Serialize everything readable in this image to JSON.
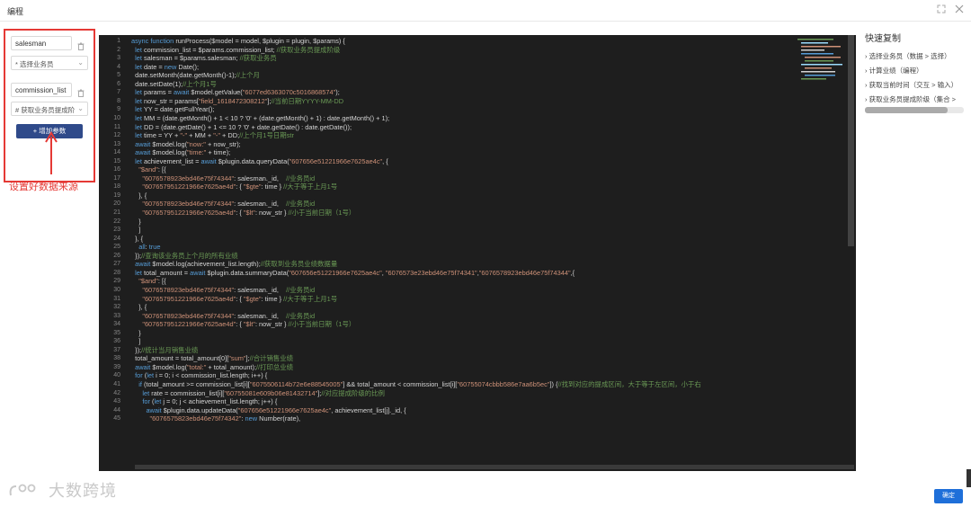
{
  "window": {
    "title": "编程",
    "expand_icon": "expand-icon",
    "close_icon": "close-icon"
  },
  "params": {
    "rows": [
      {
        "name": "salesman",
        "source": "* 选择业务员"
      },
      {
        "name": "commission_list",
        "source": "# 获取业务员提成阶"
      }
    ],
    "add_label": "+ 增加参数",
    "trash_icon": "trash-icon"
  },
  "annotation": "设置好数据来源",
  "editor": {
    "lines": [
      "async function runProcess($model = model, $plugin = plugin, $params) {",
      "  let commission_list = $params.commission_list; //获取业务员提成阶级",
      "  let salesman = $params.salesman; //获取业务员",
      "  let date = new Date();",
      "  date.setMonth(date.getMonth()-1);//上个月",
      "  date.setDate(1);//上个月1号",
      "  let params = await $model.getValue(\"6077ed6363070c5016868574\");",
      "  let now_str = params[\"field_1618472308212\"];//当前日期YYYY-MM-DD",
      "  let YY = date.getFullYear();",
      "  let MM = (date.getMonth() + 1 < 10 ? '0' + (date.getMonth() + 1) : date.getMonth() + 1);",
      "  let DD = (date.getDate() + 1 <= 10 ? '0' + date.getDate() : date.getDate());",
      "  let time = YY + \"-\" + MM + \"-\" + DD;//上个月1号日期str",
      "  await $model.log(\"now:\" + now_str);",
      "  await $model.log(\"time:\" + time);",
      "  let achievement_list = await $plugin.data.queryData(\"607656e51221966e7625ae4c\", {",
      "    \"$and\": [{",
      "      \"6076578923ebd46e75f74344\": salesman._id,    //业务员id",
      "      \"607657951221966e7625ae4d\": { \"$gte\": time } //大于等于上月1号",
      "    }, {",
      "      \"6076578923ebd46e75f74344\": salesman._id,    //业务员id",
      "      \"607657951221966e7625ae4d\": { \"$lt\": now_str } //小于当前日期（1号）",
      "    }",
      "    ]",
      "  }, {",
      "    all: true",
      "  });//查询该业务员上个月的所有业绩",
      "  await $model.log(achievement_list.length);//获取到业务员业绩数据量",
      "  let total_amount = await $plugin.data.summaryData(\"607656e51221966e7625ae4c\", \"6076573e23ebd46e75f74341\",\"6076578923ebd46e75f74344\",{",
      "    \"$and\": [{",
      "      \"6076578923ebd46e75f74344\": salesman._id,    //业务员id",
      "      \"607657951221966e7625ae4d\": { \"$gte\": time } //大于等于上月1号",
      "    }, {",
      "      \"6076578923ebd46e75f74344\": salesman._id,    //业务员id",
      "      \"607657951221966e7625ae4d\": { \"$lt\": now_str } //小于当前日期（1号）",
      "    }",
      "    ]",
      "  });//统计当月销售业绩",
      "  total_amount = total_amount[0][\"sum\"];//合计销售业绩",
      "  await $model.log(\"total:\" + total_amount);//打印总业绩",
      "  for (let i = 0; i < commission_list.length; i++) {",
      "    if (total_amount >= commission_list[i][\"6075506114b72e6e88545005\"] && total_amount < commission_list[i][\"60755074cbbb586e7aa6b5ec\"]) {//找到对应的提成区间，大于等于左区间，小于右",
      "      let rate = commission_list[i][\"60755081e609b06e81432714\"];//对应提成阶级的比例",
      "      for (let j = 0; j < achievement_list.length; j++) {",
      "        await $plugin.data.updateData(\"607656e51221966e7625ae4c\", achievement_list[j]._id, {",
      "          \"6076575823ebd46e75f74342\": new Number(rate),"
    ]
  },
  "quick_copy": {
    "title": "快速复制",
    "items": [
      "› 选择业务员（数据 > 选择）",
      "› 计算业绩（编程）",
      "› 获取当前时间（交互 > 输入）",
      "› 获取业务员提成阶级（集合 >"
    ],
    "scroll_fraction": 0.84
  },
  "watermark": "大数跨境",
  "confirm_label": "确定",
  "colors": {
    "annotation_red": "#e53935",
    "add_button": "#2f4a8a",
    "confirm_button": "#1e6fd9",
    "editor_bg": "#1e1e1e"
  }
}
